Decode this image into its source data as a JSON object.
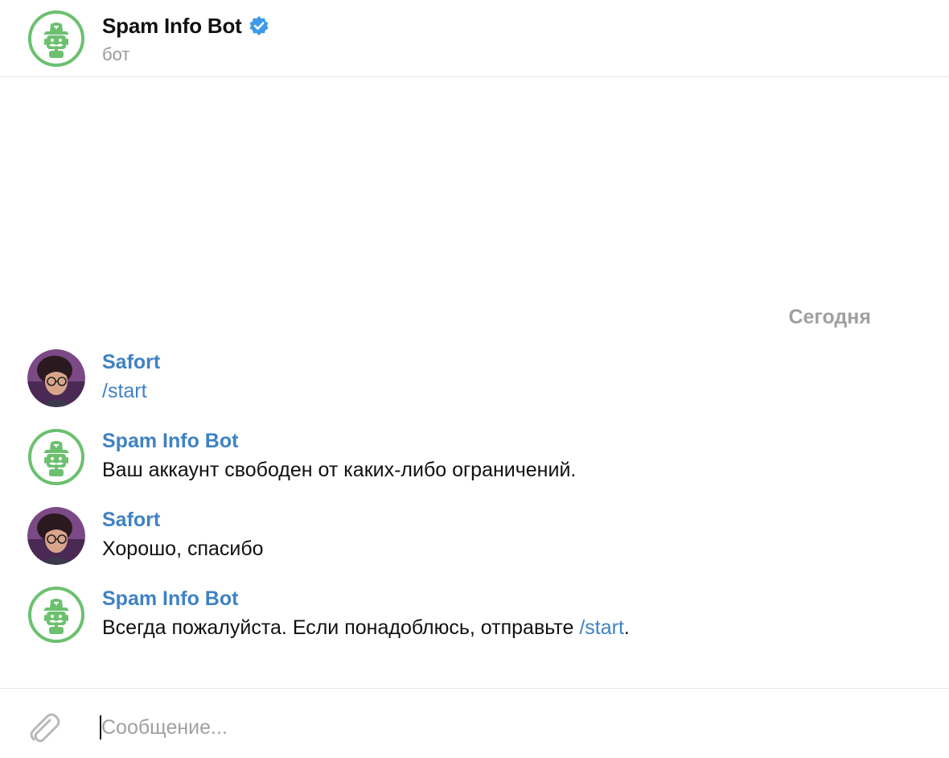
{
  "header": {
    "title": "Spam Info Bot",
    "subtitle": "бот",
    "verified_icon": "verified-badge-icon",
    "avatar_icon": "bot-avatar-icon"
  },
  "chat": {
    "date_label": "Сегодня",
    "messages": [
      {
        "sender": "Safort",
        "avatar": "user-photo-avatar",
        "text": "",
        "command": "/start",
        "text_after": ""
      },
      {
        "sender": "Spam Info Bot",
        "avatar": "bot-avatar-icon",
        "text": "Ваш аккаунт свободен от каких-либо ограничений.",
        "command": "",
        "text_after": ""
      },
      {
        "sender": "Safort",
        "avatar": "user-photo-avatar",
        "text": "Хорошо, спасибо",
        "command": "",
        "text_after": ""
      },
      {
        "sender": "Spam Info Bot",
        "avatar": "bot-avatar-icon",
        "text": "Всегда пожалуйста. Если понадоблюсь, отправьте ",
        "command": "/start",
        "text_after": "."
      }
    ]
  },
  "composer": {
    "placeholder": "Сообщение...",
    "value": "",
    "attach_icon": "paperclip-icon"
  },
  "colors": {
    "accent": "#3f82c4",
    "bot_green": "#6cc070",
    "verified_blue": "#3d9be9",
    "muted": "#a0a0a0"
  }
}
